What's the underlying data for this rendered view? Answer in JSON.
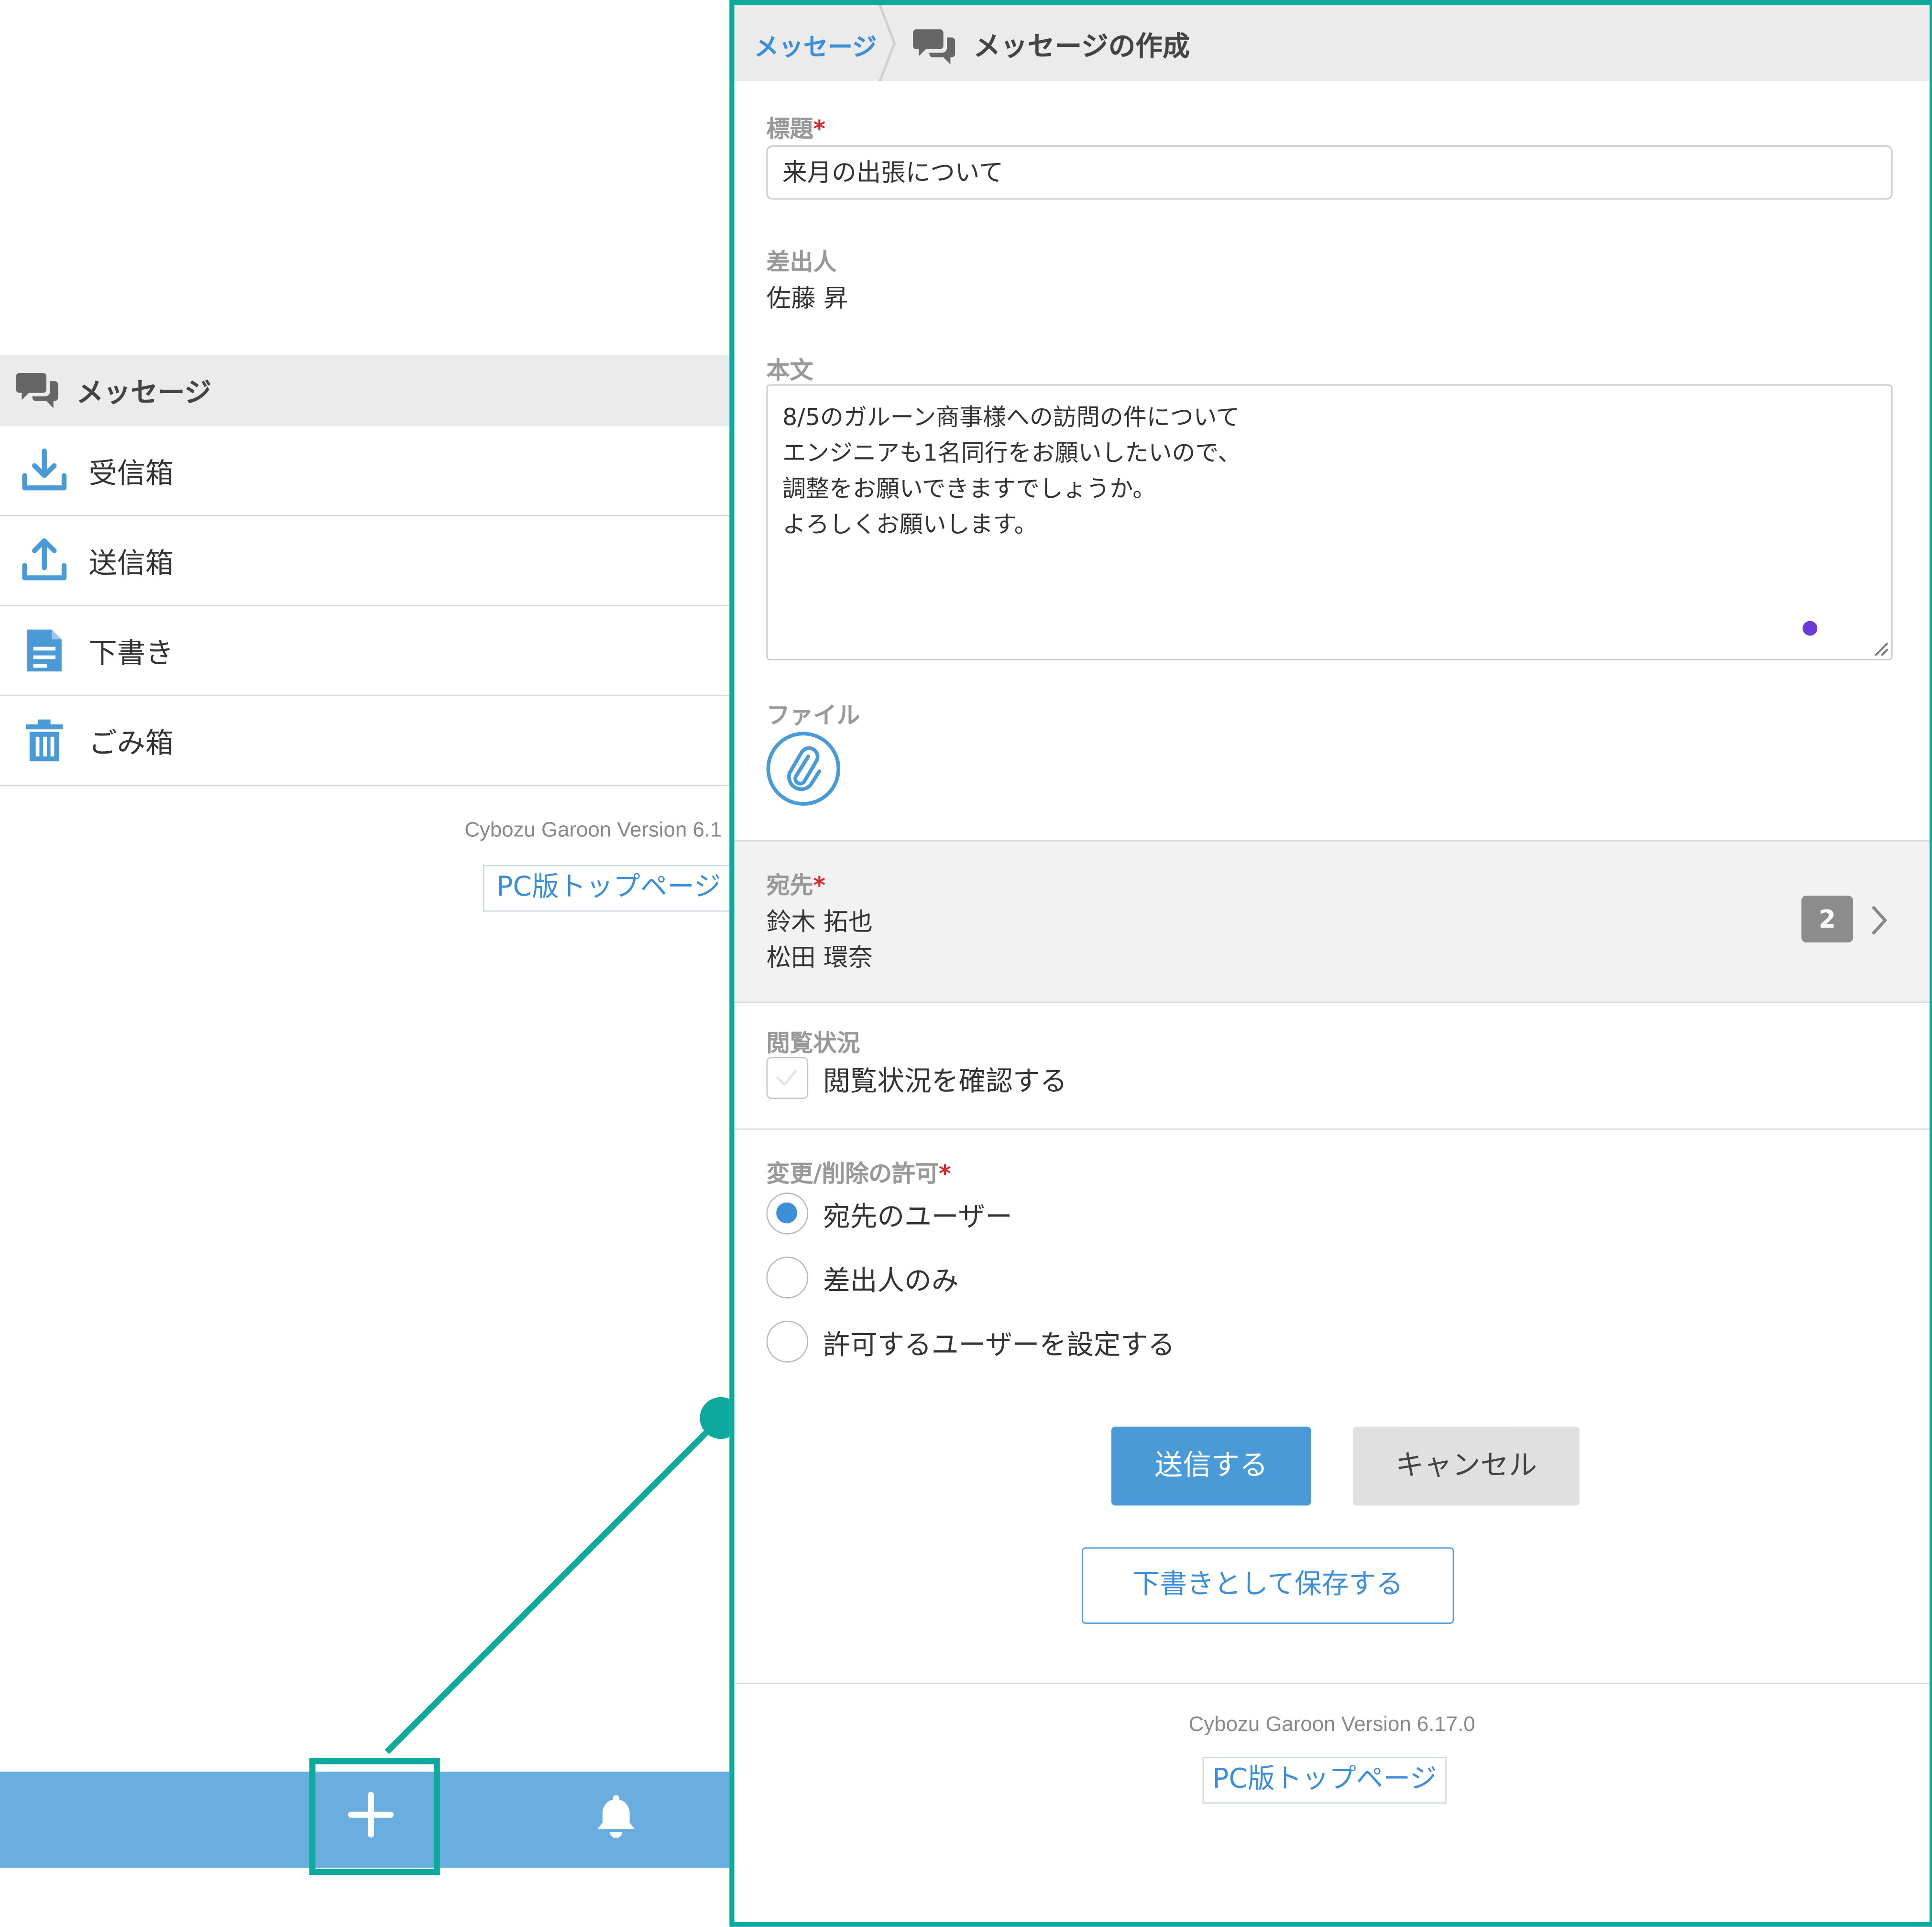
{
  "left": {
    "header_title": "メッセージ",
    "nav_items": [
      {
        "label": "受信箱",
        "icon": "inbox-download-icon"
      },
      {
        "label": "送信箱",
        "icon": "outbox-upload-icon"
      },
      {
        "label": "下書き",
        "icon": "draft-document-icon"
      },
      {
        "label": "ごみ箱",
        "icon": "trash-icon"
      }
    ],
    "version": "Cybozu Garoon Version 6.1",
    "pc_link": "PC版トップページ",
    "bottom_bar": {
      "icons": [
        "plus-icon",
        "bell-icon"
      ]
    }
  },
  "compose": {
    "breadcrumb": "メッセージ",
    "title": "メッセージの作成",
    "subject_label": "標題",
    "subject_value": "来月の出張について",
    "sender_label": "差出人",
    "sender_value": "佐藤 昇",
    "body_label": "本文",
    "body_lines": [
      "8/5のガルーン商事様への訪問の件について",
      "エンジニアも1名同行をお願いしたいので、",
      "調整をお願いできますでしょうか。",
      "よろしくお願いします。"
    ],
    "file_label": "ファイル",
    "dest_label": "宛先",
    "dest_users": [
      "鈴木 拓也",
      "松田 環奈"
    ],
    "dest_count": "2",
    "read_status_label": "閲覧状況",
    "read_status_checkbox": "閲覧状況を確認する",
    "read_status_checked": false,
    "permission_label": "変更/削除の許可",
    "permission_options": [
      "宛先のユーザー",
      "差出人のみ",
      "許可するユーザーを設定する"
    ],
    "permission_selected": "宛先のユーザー",
    "required_mark": "*",
    "send_button": "送信する",
    "cancel_button": "キャンセル",
    "draft_button": "下書きとして保存する",
    "version": "Cybozu Garoon Version 6.17.0",
    "pc_link": "PC版トップページ"
  },
  "colors": {
    "accent": "#4a9ad8",
    "highlight": "#0ea99d",
    "bottom_bar": "#6aaedf",
    "required": "#d9262c"
  }
}
